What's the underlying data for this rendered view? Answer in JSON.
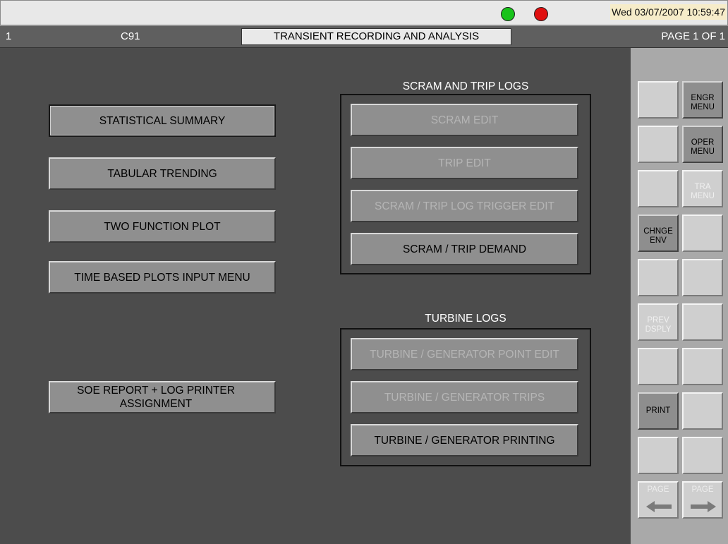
{
  "header": {
    "datetime": "Wed 03/07/2007 10:59:47",
    "indicators": [
      {
        "name": "green-status",
        "color": "#19c31b"
      },
      {
        "name": "red-status",
        "color": "#e01010"
      }
    ]
  },
  "titlebar": {
    "unit": "1",
    "code": "C91",
    "title": "TRANSIENT RECORDING AND ANALYSIS",
    "page": "PAGE 1 OF 1"
  },
  "left_buttons": [
    {
      "label": "STATISTICAL SUMMARY"
    },
    {
      "label": "TABULAR TRENDING"
    },
    {
      "label": "TWO FUNCTION PLOT"
    },
    {
      "label": "TIME BASED PLOTS INPUT MENU"
    },
    {
      "label": "SOE REPORT + LOG PRINTER ASSIGNMENT"
    }
  ],
  "scram_group": {
    "title": "SCRAM AND TRIP LOGS",
    "buttons": [
      {
        "label": "SCRAM EDIT",
        "enabled": false
      },
      {
        "label": "TRIP EDIT",
        "enabled": false
      },
      {
        "label": "SCRAM / TRIP LOG TRIGGER EDIT",
        "enabled": false
      },
      {
        "label": "SCRAM / TRIP DEMAND",
        "enabled": true
      }
    ]
  },
  "turbine_group": {
    "title": "TURBINE LOGS",
    "buttons": [
      {
        "label": "TURBINE / GENERATOR POINT EDIT",
        "enabled": false
      },
      {
        "label": "TURBINE / GENERATOR TRIPS",
        "enabled": false
      },
      {
        "label": "TURBINE / GENERATOR PRINTING",
        "enabled": true
      }
    ]
  },
  "side_panel": {
    "engr_menu": "ENGR MENU",
    "oper_menu": "OPER MENU",
    "tra_menu": "TRA MENU",
    "chnge_env": "CHNGE ENV",
    "prev_dsply": "PREV DSPLY",
    "print": "PRINT",
    "page_back": "PAGE",
    "page_fwd": "PAGE"
  },
  "colors": {
    "background": "#4c4c4c",
    "button": "#8f8f8f",
    "side_panel": "#a9a9a9",
    "datetime_bg": "#f6ecc9"
  }
}
